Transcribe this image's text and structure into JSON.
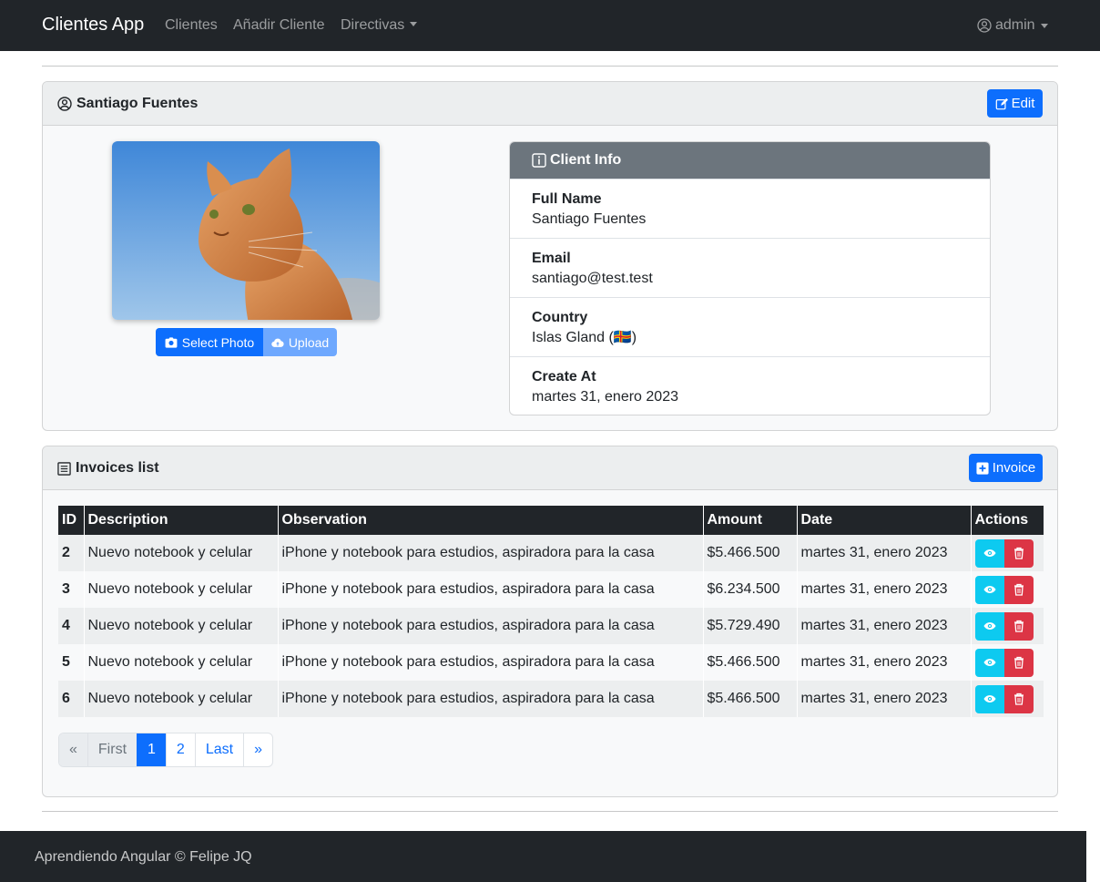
{
  "navbar": {
    "brand": "Clientes App",
    "links": [
      "Clientes",
      "Añadir Cliente",
      "Directivas"
    ],
    "user": "admin"
  },
  "client_card": {
    "title": "Santiago Fuentes",
    "edit_label": "Edit",
    "select_photo_label": "Select Photo",
    "upload_label": "Upload",
    "info": {
      "header": "Client Info",
      "items": [
        {
          "label": "Full Name",
          "value": "Santiago Fuentes"
        },
        {
          "label": "Email",
          "value": "santiago@test.test"
        },
        {
          "label": "Country",
          "value": "Islas Gland (🇦🇽)"
        },
        {
          "label": "Create At",
          "value": "martes 31, enero 2023"
        }
      ]
    }
  },
  "invoices": {
    "title": "Invoices list",
    "add_label": "Invoice",
    "columns": [
      "ID",
      "Description",
      "Observation",
      "Amount",
      "Date",
      "Actions"
    ],
    "rows": [
      {
        "id": "2",
        "description": "Nuevo notebook y celular",
        "observation": "iPhone y notebook para estudios, aspiradora para la casa",
        "amount": "$5.466.500",
        "date": "martes 31, enero 2023"
      },
      {
        "id": "3",
        "description": "Nuevo notebook y celular",
        "observation": "iPhone y notebook para estudios, aspiradora para la casa",
        "amount": "$6.234.500",
        "date": "martes 31, enero 2023"
      },
      {
        "id": "4",
        "description": "Nuevo notebook y celular",
        "observation": "iPhone y notebook para estudios, aspiradora para la casa",
        "amount": "$5.729.490",
        "date": "martes 31, enero 2023"
      },
      {
        "id": "5",
        "description": "Nuevo notebook y celular",
        "observation": "iPhone y notebook para estudios, aspiradora para la casa",
        "amount": "$5.466.500",
        "date": "martes 31, enero 2023"
      },
      {
        "id": "6",
        "description": "Nuevo notebook y celular",
        "observation": "iPhone y notebook para estudios, aspiradora para la casa",
        "amount": "$5.466.500",
        "date": "martes 31, enero 2023"
      }
    ],
    "pagination": [
      "«",
      "First",
      "1",
      "2",
      "Last",
      "»"
    ]
  },
  "footer": {
    "text": "Aprendiendo Angular © Felipe JQ"
  },
  "colors": {
    "primary": "#0d6efd",
    "dark": "#212529",
    "info": "#0dcaf0",
    "danger": "#dc3545",
    "secondary": "#6c757d"
  }
}
